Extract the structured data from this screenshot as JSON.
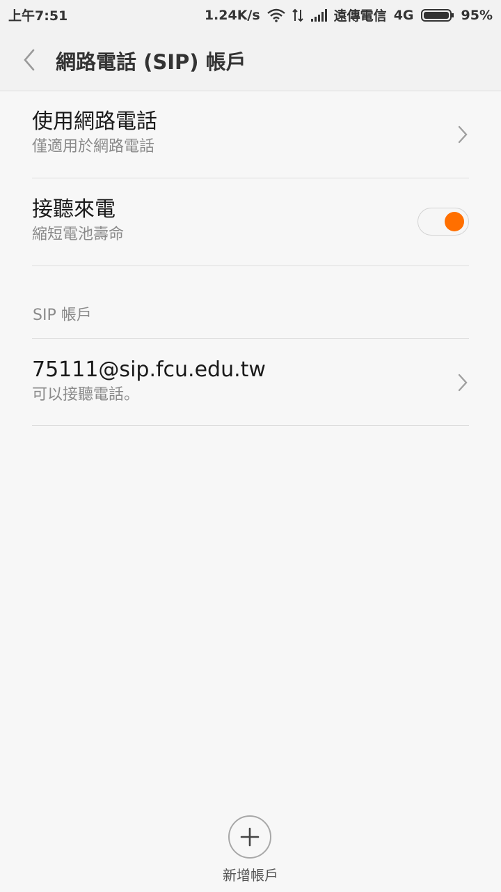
{
  "status_bar": {
    "time": "上午7:51",
    "speed": "1.24K/s",
    "carrier": "遠傳電信",
    "network": "4G",
    "battery": "95%",
    "icons": [
      "wifi-icon",
      "data-arrows-icon",
      "signal-icon",
      "battery-icon"
    ]
  },
  "header": {
    "title": "網路電話 (SIP) 帳戶"
  },
  "settings": {
    "use_sip": {
      "title": "使用網路電話",
      "subtitle": "僅適用於網路電話"
    },
    "receive_calls": {
      "title": "接聽來電",
      "subtitle": "縮短電池壽命",
      "enabled": true
    }
  },
  "section": {
    "label": "SIP 帳戶"
  },
  "accounts": [
    {
      "address": "75111@sip.fcu.edu.tw",
      "status": "可以接聽電話。"
    }
  ],
  "add_account": {
    "label": "新增帳戶"
  },
  "colors": {
    "accent": "#ff6f00",
    "background": "#f7f7f7",
    "divider": "#dddddd"
  }
}
